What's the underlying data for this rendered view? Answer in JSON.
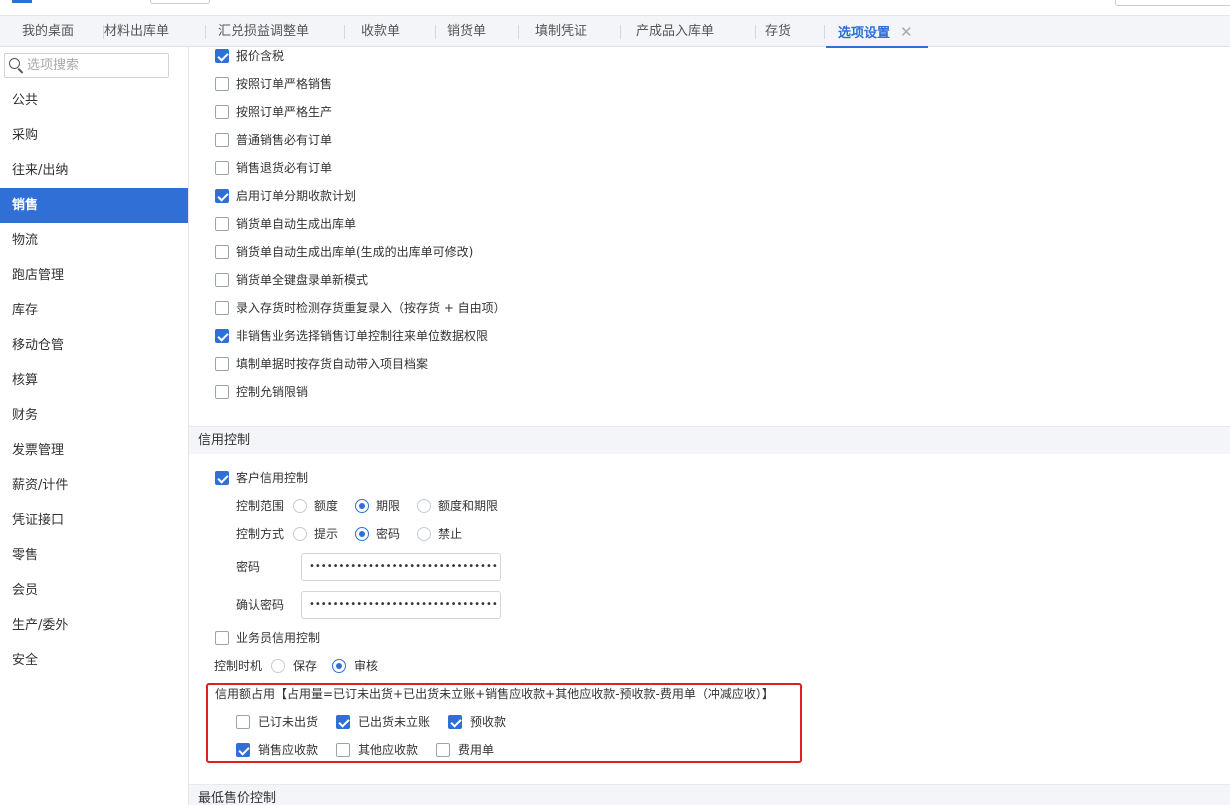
{
  "tabs": [
    {
      "label": "我的桌面"
    },
    {
      "label": "材料出库单"
    },
    {
      "label": "汇兑损益调整单"
    },
    {
      "label": "收款单"
    },
    {
      "label": "销货单"
    },
    {
      "label": "填制凭证"
    },
    {
      "label": "产成品入库单"
    },
    {
      "label": "存货"
    },
    {
      "label": "选项设置",
      "active": true
    }
  ],
  "tab_close": "✕",
  "sidebar": {
    "search_placeholder": "选项搜索",
    "items": [
      {
        "label": "公共"
      },
      {
        "label": "采购"
      },
      {
        "label": "往来/出纳"
      },
      {
        "label": "销售",
        "active": true
      },
      {
        "label": "物流"
      },
      {
        "label": "跑店管理"
      },
      {
        "label": "库存"
      },
      {
        "label": "移动仓管"
      },
      {
        "label": "核算"
      },
      {
        "label": "财务"
      },
      {
        "label": "发票管理"
      },
      {
        "label": "薪资/计件"
      },
      {
        "label": "凭证接口"
      },
      {
        "label": "零售"
      },
      {
        "label": "会员"
      },
      {
        "label": "生产/委外"
      },
      {
        "label": "安全"
      }
    ]
  },
  "sales_options": [
    {
      "label": "报价含税",
      "checked": true
    },
    {
      "label": "按照订单严格销售",
      "checked": false
    },
    {
      "label": "按照订单严格生产",
      "checked": false
    },
    {
      "label": "普通销售必有订单",
      "checked": false
    },
    {
      "label": "销售退货必有订单",
      "checked": false
    },
    {
      "label": "启用订单分期收款计划",
      "checked": true
    },
    {
      "label": "销货单自动生成出库单",
      "checked": false
    },
    {
      "label": "销货单自动生成出库单(生成的出库单可修改)",
      "checked": false
    },
    {
      "label": "销货单全键盘录单新模式",
      "checked": false
    },
    {
      "label": "录入存货时检测存货重复录入（按存货 + 自由项）",
      "checked": false
    },
    {
      "label": "非销售业务选择销售订单控制往来单位数据权限",
      "checked": true
    },
    {
      "label": "填制单据时按存货自动带入项目档案",
      "checked": false
    },
    {
      "label": "控制允销限销",
      "checked": false
    }
  ],
  "credit": {
    "section_title": "信用控制",
    "customer_credit": {
      "label": "客户信用控制",
      "checked": true
    },
    "scope": {
      "label": "控制范围",
      "options": [
        {
          "label": "额度",
          "checked": false
        },
        {
          "label": "期限",
          "checked": true
        },
        {
          "label": "额度和期限",
          "checked": false
        }
      ]
    },
    "mode": {
      "label": "控制方式",
      "options": [
        {
          "label": "提示",
          "checked": false
        },
        {
          "label": "密码",
          "checked": true
        },
        {
          "label": "禁止",
          "checked": false
        }
      ]
    },
    "password": {
      "label": "密码",
      "value": "••••••••••••••••••••••••••••••••"
    },
    "confirm_password": {
      "label": "确认密码",
      "value": "••••••••••••••••••••••••••••••••"
    },
    "salesman_credit": {
      "label": "业务员信用控制",
      "checked": false
    },
    "timing": {
      "label": "控制时机",
      "options": [
        {
          "label": "保存",
          "checked": false
        },
        {
          "label": "审核",
          "checked": true
        }
      ]
    },
    "occupation": {
      "label": "信用额占用【占用量=已订未出货+已出货未立账+销售应收款+其他应收款-预收款-费用单（冲减应收）】",
      "row1": [
        {
          "label": "已订未出货",
          "checked": false
        },
        {
          "label": "已出货未立账",
          "checked": true
        },
        {
          "label": "预收款",
          "checked": true
        }
      ],
      "row2": [
        {
          "label": "销售应收款",
          "checked": true
        },
        {
          "label": "其他应收款",
          "checked": false
        },
        {
          "label": "费用单",
          "checked": false
        }
      ]
    },
    "highlight_color": "#e02020"
  },
  "min_price": {
    "section_title": "最低售价控制"
  },
  "colors": {
    "accent": "#2f6fd6",
    "section_bg": "#f3f5f8"
  }
}
